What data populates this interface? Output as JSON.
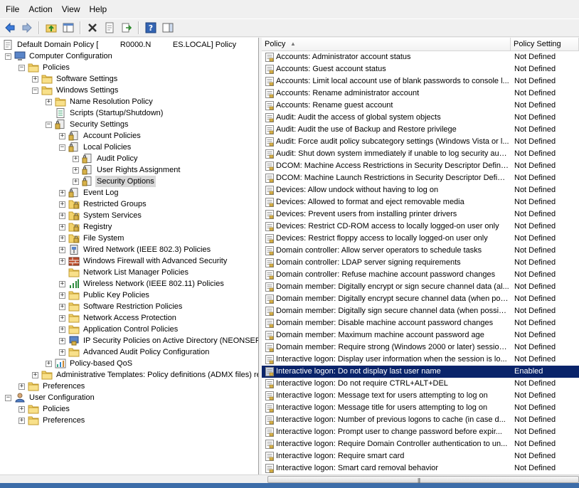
{
  "menu": [
    "File",
    "Action",
    "View",
    "Help"
  ],
  "toolbar": [
    {
      "name": "back-button",
      "icon": "arrow-left-icon"
    },
    {
      "name": "forward-button",
      "icon": "arrow-right-icon"
    },
    {
      "name": "up-folder-button",
      "icon": "folder-up-icon"
    },
    {
      "name": "show-hide-tree-button",
      "icon": "console-tree-icon"
    },
    {
      "name": "delete-button",
      "icon": "delete-x-icon"
    },
    {
      "name": "properties-button",
      "icon": "properties-icon"
    },
    {
      "name": "export-list-button",
      "icon": "export-icon"
    },
    {
      "name": "help-button",
      "icon": "help-icon"
    },
    {
      "name": "show-action-pane-button",
      "icon": "action-pane-icon"
    }
  ],
  "tree": [
    {
      "label": "Default Domain Policy [          R0000.N          ES.LOCAL] Policy",
      "level": 0,
      "exp": "",
      "icon": "policy-doc"
    },
    {
      "label": "Computer Configuration",
      "level": 0,
      "exp": "-",
      "icon": "computer"
    },
    {
      "label": "Policies",
      "level": 1,
      "exp": "-",
      "icon": "folder"
    },
    {
      "label": "Software Settings",
      "level": 2,
      "exp": "+",
      "icon": "folder"
    },
    {
      "label": "Windows Settings",
      "level": 2,
      "exp": "-",
      "icon": "folder"
    },
    {
      "label": "Name Resolution Policy",
      "level": 3,
      "exp": "+",
      "icon": "folder"
    },
    {
      "label": "Scripts (Startup/Shutdown)",
      "level": 3,
      "exp": "",
      "icon": "script"
    },
    {
      "label": "Security Settings",
      "level": 3,
      "exp": "-",
      "icon": "security"
    },
    {
      "label": "Account Policies",
      "level": 4,
      "exp": "+",
      "icon": "security"
    },
    {
      "label": "Local Policies",
      "level": 4,
      "exp": "-",
      "icon": "security"
    },
    {
      "label": "Audit Policy",
      "level": 5,
      "exp": "+",
      "icon": "security"
    },
    {
      "label": "User Rights Assignment",
      "level": 5,
      "exp": "+",
      "icon": "security"
    },
    {
      "label": "Security Options",
      "level": 5,
      "exp": "+",
      "icon": "security",
      "selected": true
    },
    {
      "label": "Event Log",
      "level": 4,
      "exp": "+",
      "icon": "security"
    },
    {
      "label": "Restricted Groups",
      "level": 4,
      "exp": "+",
      "icon": "lock-folder"
    },
    {
      "label": "System Services",
      "level": 4,
      "exp": "+",
      "icon": "lock-folder"
    },
    {
      "label": "Registry",
      "level": 4,
      "exp": "+",
      "icon": "lock-folder"
    },
    {
      "label": "File System",
      "level": 4,
      "exp": "+",
      "icon": "lock-folder"
    },
    {
      "label": "Wired Network (IEEE 802.3) Policies",
      "level": 4,
      "exp": "+",
      "icon": "network"
    },
    {
      "label": "Windows Firewall with Advanced Security",
      "level": 4,
      "exp": "+",
      "icon": "firewall"
    },
    {
      "label": "Network List Manager Policies",
      "level": 4,
      "exp": "",
      "icon": "folder"
    },
    {
      "label": "Wireless Network (IEEE 802.11) Policies",
      "level": 4,
      "exp": "+",
      "icon": "wireless"
    },
    {
      "label": "Public Key Policies",
      "level": 4,
      "exp": "+",
      "icon": "folder"
    },
    {
      "label": "Software Restriction Policies",
      "level": 4,
      "exp": "+",
      "icon": "folder"
    },
    {
      "label": "Network Access Protection",
      "level": 4,
      "exp": "+",
      "icon": "folder"
    },
    {
      "label": "Application Control Policies",
      "level": 4,
      "exp": "+",
      "icon": "folder"
    },
    {
      "label": "IP Security Policies on Active Directory (NEONSERV",
      "level": 4,
      "exp": "+",
      "icon": "ipsec"
    },
    {
      "label": "Advanced Audit Policy Configuration",
      "level": 4,
      "exp": "+",
      "icon": "folder"
    },
    {
      "label": "Policy-based QoS",
      "level": 3,
      "exp": "+",
      "icon": "qos"
    },
    {
      "label": "Administrative Templates: Policy definitions (ADMX files) re",
      "level": 2,
      "exp": "+",
      "icon": "folder"
    },
    {
      "label": "Preferences",
      "level": 1,
      "exp": "+",
      "icon": "folder"
    },
    {
      "label": "User Configuration",
      "level": 0,
      "exp": "-",
      "icon": "user"
    },
    {
      "label": "Policies",
      "level": 1,
      "exp": "+",
      "icon": "folder"
    },
    {
      "label": "Preferences",
      "level": 1,
      "exp": "+",
      "icon": "folder"
    }
  ],
  "columns": {
    "policy": "Policy",
    "setting": "Policy Setting"
  },
  "policies": [
    {
      "name": "Accounts: Administrator account status",
      "setting": "Not Defined"
    },
    {
      "name": "Accounts: Guest account status",
      "setting": "Not Defined"
    },
    {
      "name": "Accounts: Limit local account use of blank passwords to console l...",
      "setting": "Not Defined"
    },
    {
      "name": "Accounts: Rename administrator account",
      "setting": "Not Defined"
    },
    {
      "name": "Accounts: Rename guest account",
      "setting": "Not Defined"
    },
    {
      "name": "Audit: Audit the access of global system objects",
      "setting": "Not Defined"
    },
    {
      "name": "Audit: Audit the use of Backup and Restore privilege",
      "setting": "Not Defined"
    },
    {
      "name": "Audit: Force audit policy subcategory settings (Windows Vista or l...",
      "setting": "Not Defined"
    },
    {
      "name": "Audit: Shut down system immediately if unable to log security audits",
      "setting": "Not Defined"
    },
    {
      "name": "DCOM: Machine Access Restrictions in Security Descriptor Definiti...",
      "setting": "Not Defined"
    },
    {
      "name": "DCOM: Machine Launch Restrictions in Security Descriptor Definiti...",
      "setting": "Not Defined"
    },
    {
      "name": "Devices: Allow undock without having to log on",
      "setting": "Not Defined"
    },
    {
      "name": "Devices: Allowed to format and eject removable media",
      "setting": "Not Defined"
    },
    {
      "name": "Devices: Prevent users from installing printer drivers",
      "setting": "Not Defined"
    },
    {
      "name": "Devices: Restrict CD-ROM access to locally logged-on user only",
      "setting": "Not Defined"
    },
    {
      "name": "Devices: Restrict floppy access to locally logged-on user only",
      "setting": "Not Defined"
    },
    {
      "name": "Domain controller: Allow server operators to schedule tasks",
      "setting": "Not Defined"
    },
    {
      "name": "Domain controller: LDAP server signing requirements",
      "setting": "Not Defined"
    },
    {
      "name": "Domain controller: Refuse machine account password changes",
      "setting": "Not Defined"
    },
    {
      "name": "Domain member: Digitally encrypt or sign secure channel data (al...",
      "setting": "Not Defined"
    },
    {
      "name": "Domain member: Digitally encrypt secure channel data (when pos...",
      "setting": "Not Defined"
    },
    {
      "name": "Domain member: Digitally sign secure channel data (when possible)",
      "setting": "Not Defined"
    },
    {
      "name": "Domain member: Disable machine account password changes",
      "setting": "Not Defined"
    },
    {
      "name": "Domain member: Maximum machine account password age",
      "setting": "Not Defined"
    },
    {
      "name": "Domain member: Require strong (Windows 2000 or later) session ...",
      "setting": "Not Defined"
    },
    {
      "name": "Interactive logon: Display user information when the session is lo...",
      "setting": "Not Defined"
    },
    {
      "name": "Interactive logon: Do not display last user name",
      "setting": "Enabled",
      "selected": true
    },
    {
      "name": "Interactive logon: Do not require CTRL+ALT+DEL",
      "setting": "Not Defined"
    },
    {
      "name": "Interactive logon: Message text for users attempting to log on",
      "setting": "Not Defined"
    },
    {
      "name": "Interactive logon: Message title for users attempting to log on",
      "setting": "Not Defined"
    },
    {
      "name": "Interactive logon: Number of previous logons to cache (in case d...",
      "setting": "Not Defined"
    },
    {
      "name": "Interactive logon: Prompt user to change password before expir...",
      "setting": "Not Defined"
    },
    {
      "name": "Interactive logon: Require Domain Controller authentication to un...",
      "setting": "Not Defined"
    },
    {
      "name": "Interactive logon: Require smart card",
      "setting": "Not Defined"
    },
    {
      "name": "Interactive logon: Smart card removal behavior",
      "setting": "Not Defined"
    }
  ],
  "colors": {
    "selection": "#0a246a",
    "tree_selection": "#d9d9d9",
    "folder": "#f3d36b",
    "status": "#3c6ca8"
  }
}
